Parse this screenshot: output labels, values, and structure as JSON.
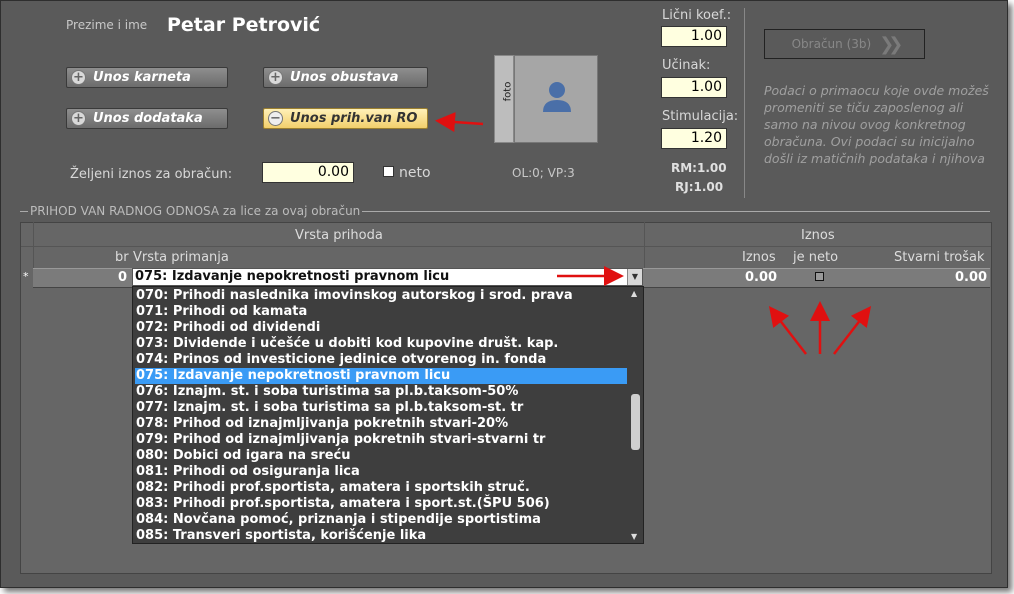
{
  "employee": {
    "name_label": "Prezime i ime",
    "name": "Petar Petrović"
  },
  "buttons": {
    "unos_karneta": "Unos karneta",
    "unos_obustava": "Unos obustava",
    "unos_dodataka": "Unos dodataka",
    "unos_prih_van_ro": "Unos prih.van RO"
  },
  "zeljeni": {
    "label": "Željeni iznos za obračun:",
    "value": "0.00",
    "neto_label": "neto"
  },
  "foto": {
    "label": "foto"
  },
  "ol_vp": "OL:0;  VP:3",
  "coefs": {
    "licni_label": "Lični koef.:",
    "licni_value": "1.00",
    "ucinak_label": "Učinak:",
    "ucinak_value": "1.00",
    "stim_label": "Stimulacija:",
    "stim_value": "1.20",
    "rm": "RM:1.00",
    "rj": "RJ:1.00"
  },
  "obracun_button": "Obračun (3b)",
  "info_text": "Podaci o primaocu koje ovde možeš promeniti se tiču zaposlenog ali samo na nivou ovog konkretnog obračuna. Ovi podaci su inicijalno došli iz matičnih podataka i njihova",
  "group_title": "PRIHOD VAN RADNOG ODNOSA za lice za ovaj obračun",
  "grid": {
    "band_vrsta": "Vrsta prihoda",
    "band_iznos": "Iznos",
    "col_br": "br",
    "col_vrsta": "Vrsta primanja",
    "col_iznos": "Iznos",
    "col_jeneto": "je neto",
    "col_trosak": "Stvarni trošak",
    "row": {
      "marker": "*",
      "br": "0",
      "vrsta": "075: Izdavanje nepokretnosti pravnom licu",
      "iznos": "0.00",
      "trosak": "0.00"
    }
  },
  "dropdown": {
    "selected_index": 5,
    "items": [
      "070: Prihodi naslednika imovinskog autorskog i srod. prava",
      "071: Prihodi od kamata",
      "072: Prihodi od dividendi",
      "073: Dividende i učešće u dobiti kod kupovine društ. kap.",
      "074: Prinos od investicione jedinice otvorenog in. fonda",
      "075: Izdavanje nepokretnosti pravnom licu",
      "076: Iznajm. st. i soba turistima sa pl.b.taksom-50%",
      "077: Iznajm. st. i soba turistima sa pl.b.taksom-st. tr",
      "078: Prihod od iznajmljivanja pokretnih stvari-20%",
      "079: Prihod od iznajmljivanja pokretnih stvari-stvarni tr",
      "080: Dobici od igara na sreću",
      "081: Prihodi od osiguranja lica",
      "082: Prihodi prof.sportista, amatera i sportskih struč.",
      "083: Prihodi prof.sportista, amatera i sport.st.(ŠPU 506)",
      "084: Novčana pomoć, priznanja i stipendije sportistima",
      "085: Transveri sportista, korišćenje lika"
    ]
  },
  "colors": {
    "accent_arrow": "#e01010",
    "selection": "#3a9bf5",
    "input_bg": "#ffffe0"
  }
}
